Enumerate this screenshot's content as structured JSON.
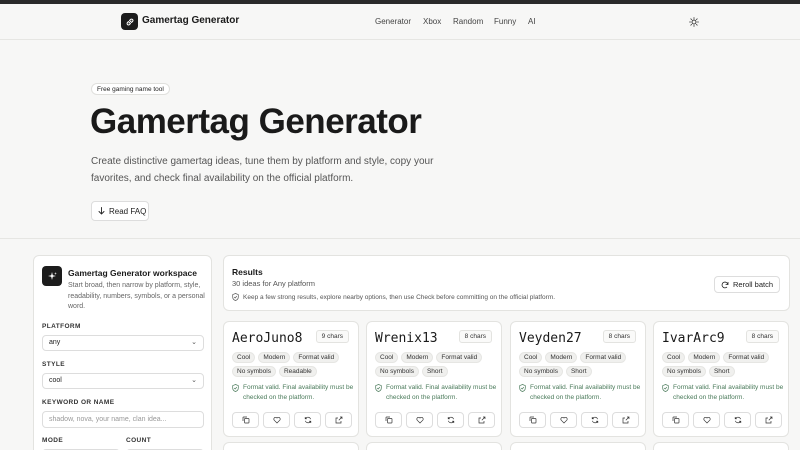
{
  "header": {
    "brand": "Gamertag Generator",
    "nav": [
      "Generator",
      "Xbox",
      "Random",
      "Funny",
      "AI"
    ]
  },
  "hero": {
    "badge": "Free gaming name tool",
    "title": "Gamertag Generator",
    "description": "Create distinctive gamertag ideas, tune them by platform and style, copy your favorites, and check final availability on the official platform.",
    "faq_label": "Read FAQ"
  },
  "workspace": {
    "title": "Gamertag Generator workspace",
    "description": "Start broad, then narrow by platform, style, readability, numbers, symbols, or a personal word.",
    "platform_label": "PLATFORM",
    "platform_value": "any",
    "style_label": "STYLE",
    "style_value": "cool",
    "keyword_label": "KEYWORD OR NAME",
    "keyword_placeholder": "shadow, nova, your name, clan idea...",
    "mode_label": "MODE",
    "count_label": "COUNT"
  },
  "results": {
    "title": "Results",
    "subtitle": "30 ideas for Any platform",
    "hint": "Keep a few strong results, explore nearby options, then use Check before committing on the official platform.",
    "reroll_label": "Reroll batch"
  },
  "cards": [
    {
      "name": "AeroJuno8",
      "chars": "9 chars",
      "tags": [
        "Cool",
        "Modern",
        "Format valid",
        "No symbols",
        "Readable"
      ],
      "note": "Format valid. Final availability must be checked on the platform."
    },
    {
      "name": "Wrenix13",
      "chars": "8 chars",
      "tags": [
        "Cool",
        "Modern",
        "Format valid",
        "No symbols",
        "Short"
      ],
      "note": "Format valid. Final availability must be checked on the platform."
    },
    {
      "name": "Veyden27",
      "chars": "8 chars",
      "tags": [
        "Cool",
        "Modern",
        "Format valid",
        "No symbols",
        "Short"
      ],
      "note": "Format valid. Final availability must be checked on the platform."
    },
    {
      "name": "IvarArc9",
      "chars": "8 chars",
      "tags": [
        "Cool",
        "Modern",
        "Format valid",
        "No symbols",
        "Short"
      ],
      "note": "Format valid. Final availability must be checked on the platform."
    }
  ],
  "icons": {
    "logo": "link-icon",
    "theme": "sun-icon",
    "faq": "arrow-down-icon",
    "workspace": "sparkle-icon",
    "reroll": "refresh-icon",
    "card_actions": [
      "copy-icon",
      "heart-icon",
      "refresh-icon",
      "external-link-icon"
    ]
  },
  "colors": {
    "accent": "#1c1c1c",
    "valid": "#4a7a5a"
  }
}
